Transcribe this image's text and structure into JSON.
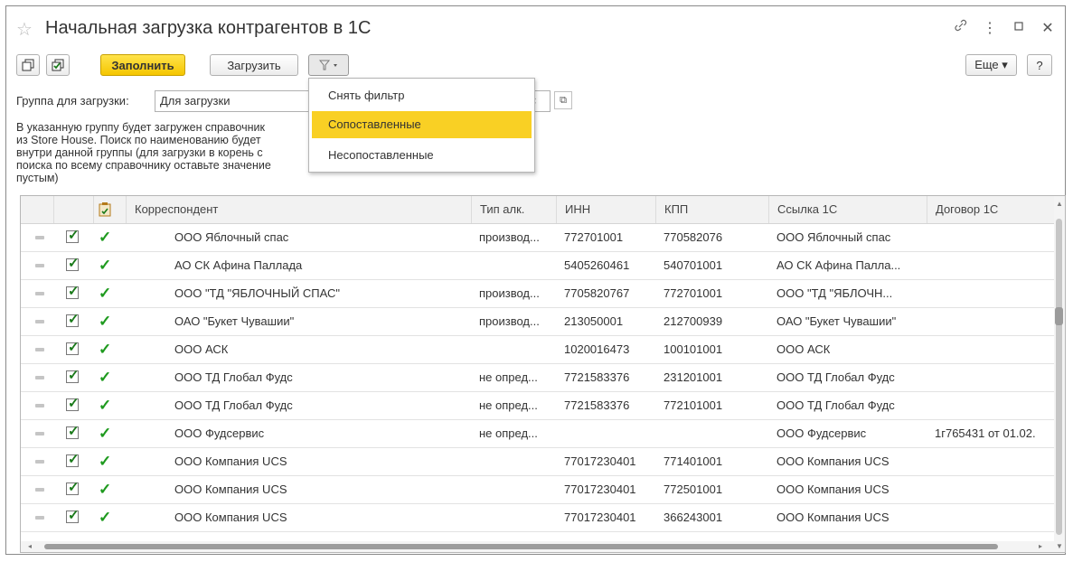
{
  "window": {
    "title": "Начальная загрузка контрагентов в 1С",
    "controls": [
      "link-icon",
      "more-icon",
      "maximize-icon",
      "close-icon"
    ]
  },
  "toolbar": {
    "fill_label": "Заполнить",
    "load_label": "Загрузить",
    "more_label": "Еще ▾",
    "help_label": "?"
  },
  "group": {
    "label": "Группа для загрузки:",
    "value": "Для загрузки"
  },
  "hint": {
    "line1": "В указанную группу будет загружен справочник",
    "line2": "из Store House. Поиск по наименованию будет",
    "line3": "внутри данной группы (для загрузки в корень с",
    "line4": "поиска по всему справочнику оставьте значение пустым)"
  },
  "filter_menu": {
    "items": [
      "Снять фильтр",
      "Сопоставленные",
      "Несопоставленные"
    ],
    "selected": 1
  },
  "table": {
    "columns": [
      "Корреспондент",
      "Тип алк.",
      "ИНН",
      "КПП",
      "Ссылка 1С",
      "Договор 1С"
    ],
    "rows": [
      [
        "ООО Яблочный спас",
        "производ...",
        "772701001",
        "770582076",
        "ООО Яблочный спас",
        ""
      ],
      [
        "АО СК Афина Паллада",
        "",
        "5405260461",
        "540701001",
        "АО СК Афина Палла...",
        ""
      ],
      [
        "ООО \"ТД \"ЯБЛОЧНЫЙ СПАС\"",
        "производ...",
        "7705820767",
        "772701001",
        "ООО \"ТД \"ЯБЛОЧН...",
        ""
      ],
      [
        "ОАО \"Букет Чувашии\"",
        "производ...",
        "213050001",
        "212700939",
        "ОАО \"Букет Чувашии\"",
        ""
      ],
      [
        "ООО АСК",
        "",
        "1020016473",
        "100101001",
        "ООО АСК",
        ""
      ],
      [
        "ООО ТД Глобал Фудс",
        "не опред...",
        "7721583376",
        "231201001",
        "ООО ТД Глобал Фудс",
        ""
      ],
      [
        "ООО ТД Глобал Фудс",
        "не опред...",
        "7721583376",
        "772101001",
        "ООО ТД Глобал Фудс",
        ""
      ],
      [
        "ООО Фудсервис",
        "не опред...",
        "",
        "",
        "ООО Фудсервис",
        "1г765431 от 01.02."
      ],
      [
        "ООО Компания UCS",
        "",
        "77017230401",
        "771401001",
        "ООО Компания UCS",
        ""
      ],
      [
        "ООО Компания UCS",
        "",
        "77017230401",
        "772501001",
        "ООО Компания UCS",
        ""
      ],
      [
        "ООО Компания UCS",
        "",
        "77017230401",
        "366243001",
        "ООО Компания UCS",
        ""
      ]
    ]
  },
  "colors": {
    "accent_yellow": "#f9d024",
    "check_green": "#1e9a1e"
  }
}
